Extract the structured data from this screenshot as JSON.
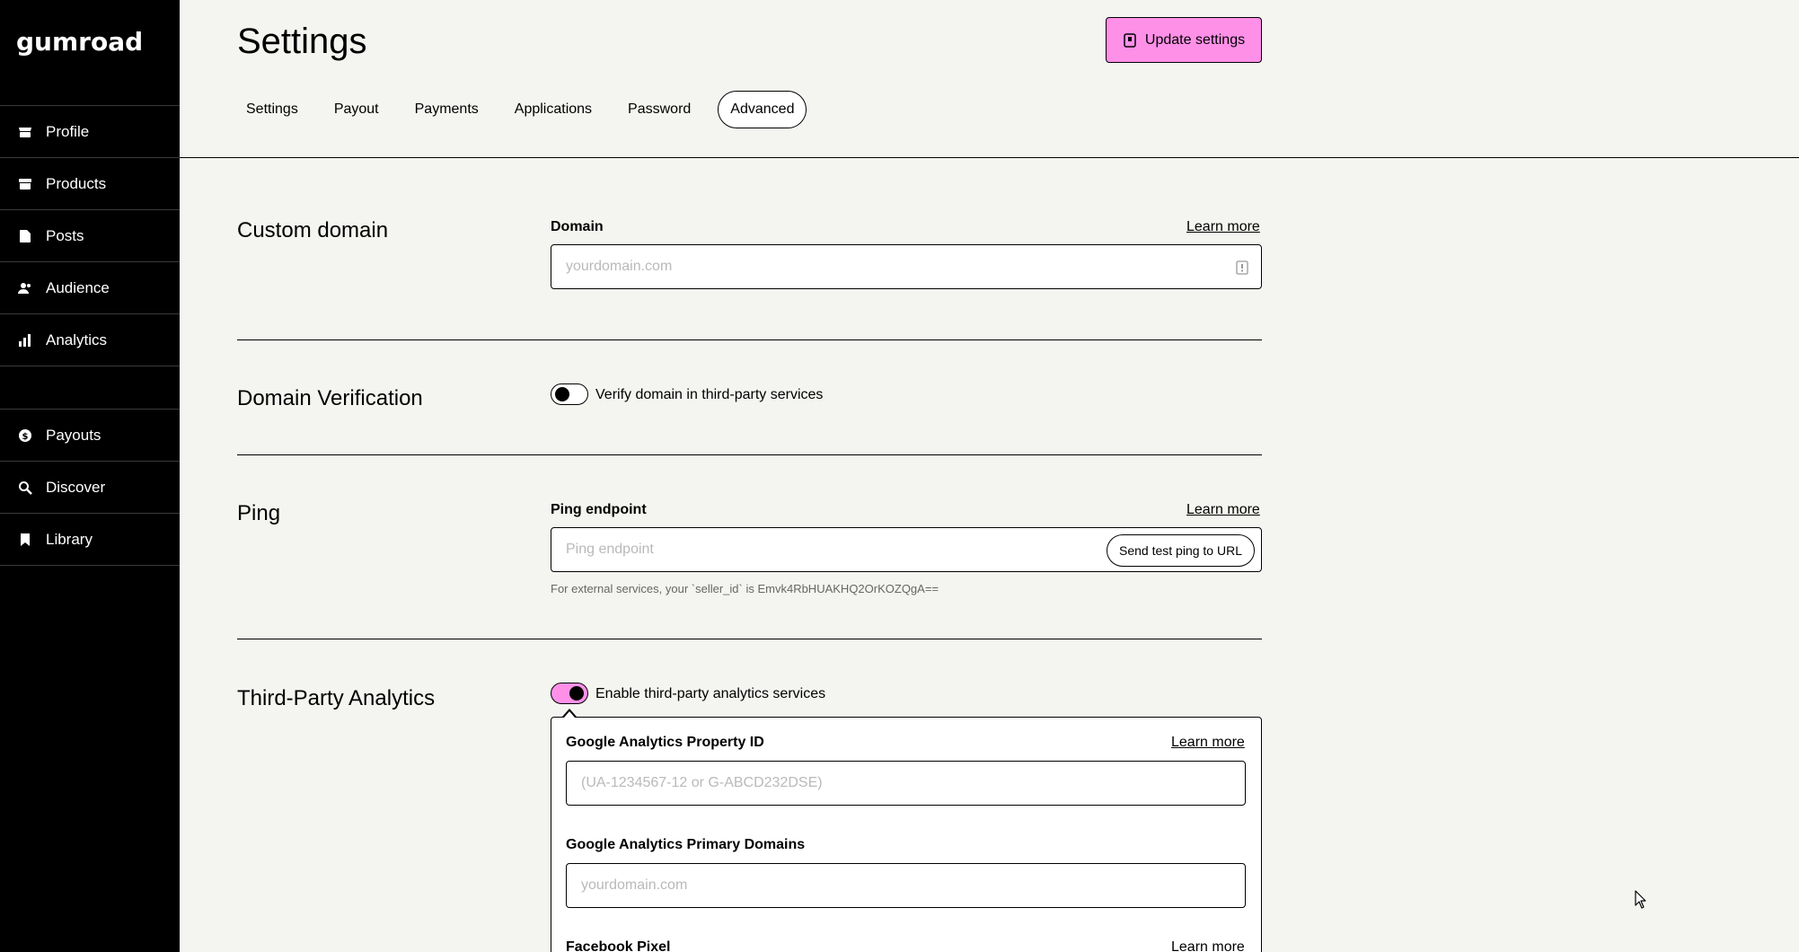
{
  "brand": {
    "logo_text": "gumroad"
  },
  "sidebar": {
    "items": [
      {
        "label": "Profile",
        "icon": "shop-icon"
      },
      {
        "label": "Products",
        "icon": "archive-icon"
      },
      {
        "label": "Posts",
        "icon": "document-icon"
      },
      {
        "label": "Audience",
        "icon": "people-icon"
      },
      {
        "label": "Analytics",
        "icon": "bar-chart-icon"
      }
    ],
    "items2": [
      {
        "label": "Payouts",
        "icon": "dollar-circle-icon"
      },
      {
        "label": "Discover",
        "icon": "search-icon"
      },
      {
        "label": "Library",
        "icon": "bookmark-icon"
      }
    ]
  },
  "header": {
    "title": "Settings",
    "update_button": "Update settings",
    "tabs": [
      {
        "label": "Settings",
        "active": false
      },
      {
        "label": "Payout",
        "active": false
      },
      {
        "label": "Payments",
        "active": false
      },
      {
        "label": "Applications",
        "active": false
      },
      {
        "label": "Password",
        "active": false
      },
      {
        "label": "Advanced",
        "active": true
      }
    ]
  },
  "sections": {
    "custom_domain": {
      "title": "Custom domain",
      "label": "Domain",
      "learn_more": "Learn more",
      "placeholder": "yourdomain.com"
    },
    "domain_verification": {
      "title": "Domain Verification",
      "toggle_label": "Verify domain in third-party services",
      "toggle_on": false
    },
    "ping": {
      "title": "Ping",
      "label": "Ping endpoint",
      "learn_more": "Learn more",
      "placeholder": "Ping endpoint",
      "send_button": "Send test ping to URL",
      "hint": "For external services, your `seller_id` is Emvk4RbHUAKHQ2OrKOZQgA=="
    },
    "analytics": {
      "title": "Third-Party Analytics",
      "toggle_label": "Enable third-party analytics services",
      "toggle_on": true,
      "ga_id_label": "Google Analytics Property ID",
      "ga_id_learn_more": "Learn more",
      "ga_id_placeholder": "(UA-1234567-12 or G-ABCD232DSE)",
      "ga_domains_label": "Google Analytics Primary Domains",
      "ga_domains_placeholder": "yourdomain.com",
      "fb_pixel_label": "Facebook Pixel",
      "fb_pixel_learn_more": "Learn more"
    }
  },
  "colors": {
    "accent": "#ff90e8",
    "sidebar_bg": "#000000",
    "page_bg": "#f4f4f0"
  }
}
